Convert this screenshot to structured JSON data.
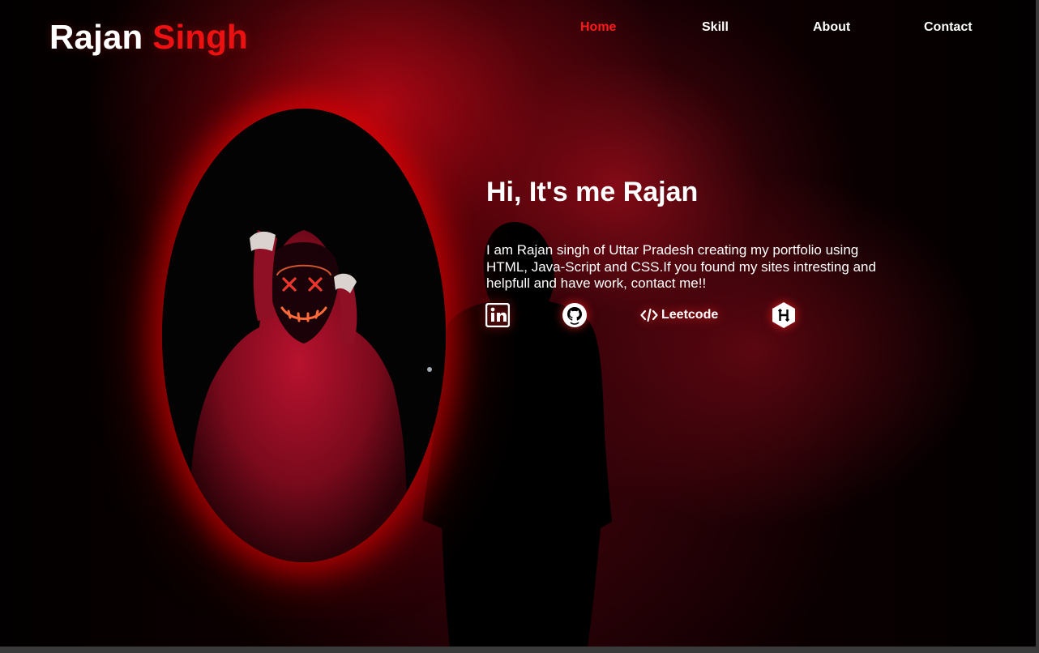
{
  "header": {
    "logo_first": "Rajan",
    "logo_second": "Singh",
    "nav": [
      {
        "label": "Home",
        "active": true
      },
      {
        "label": "Skill",
        "active": false
      },
      {
        "label": "About",
        "active": false
      },
      {
        "label": "Contact",
        "active": false
      }
    ]
  },
  "hero": {
    "greeting": "Hi, It's me Rajan",
    "description": "I am Rajan singh of Uttar Pradesh creating my portfolio using HTML, Java-Script and CSS.If you found my sites intresting and helpfull and have work, contact me!!",
    "socials": [
      {
        "icon": "linkedin-icon"
      },
      {
        "icon": "github-icon"
      },
      {
        "icon": "code-icon",
        "label": "Leetcode"
      },
      {
        "icon": "hackerrank-icon"
      }
    ]
  },
  "colors": {
    "accent": "#ee1111",
    "nav_active": "#ff1a1a",
    "text": "#ffffff",
    "background": "#0a0001"
  }
}
